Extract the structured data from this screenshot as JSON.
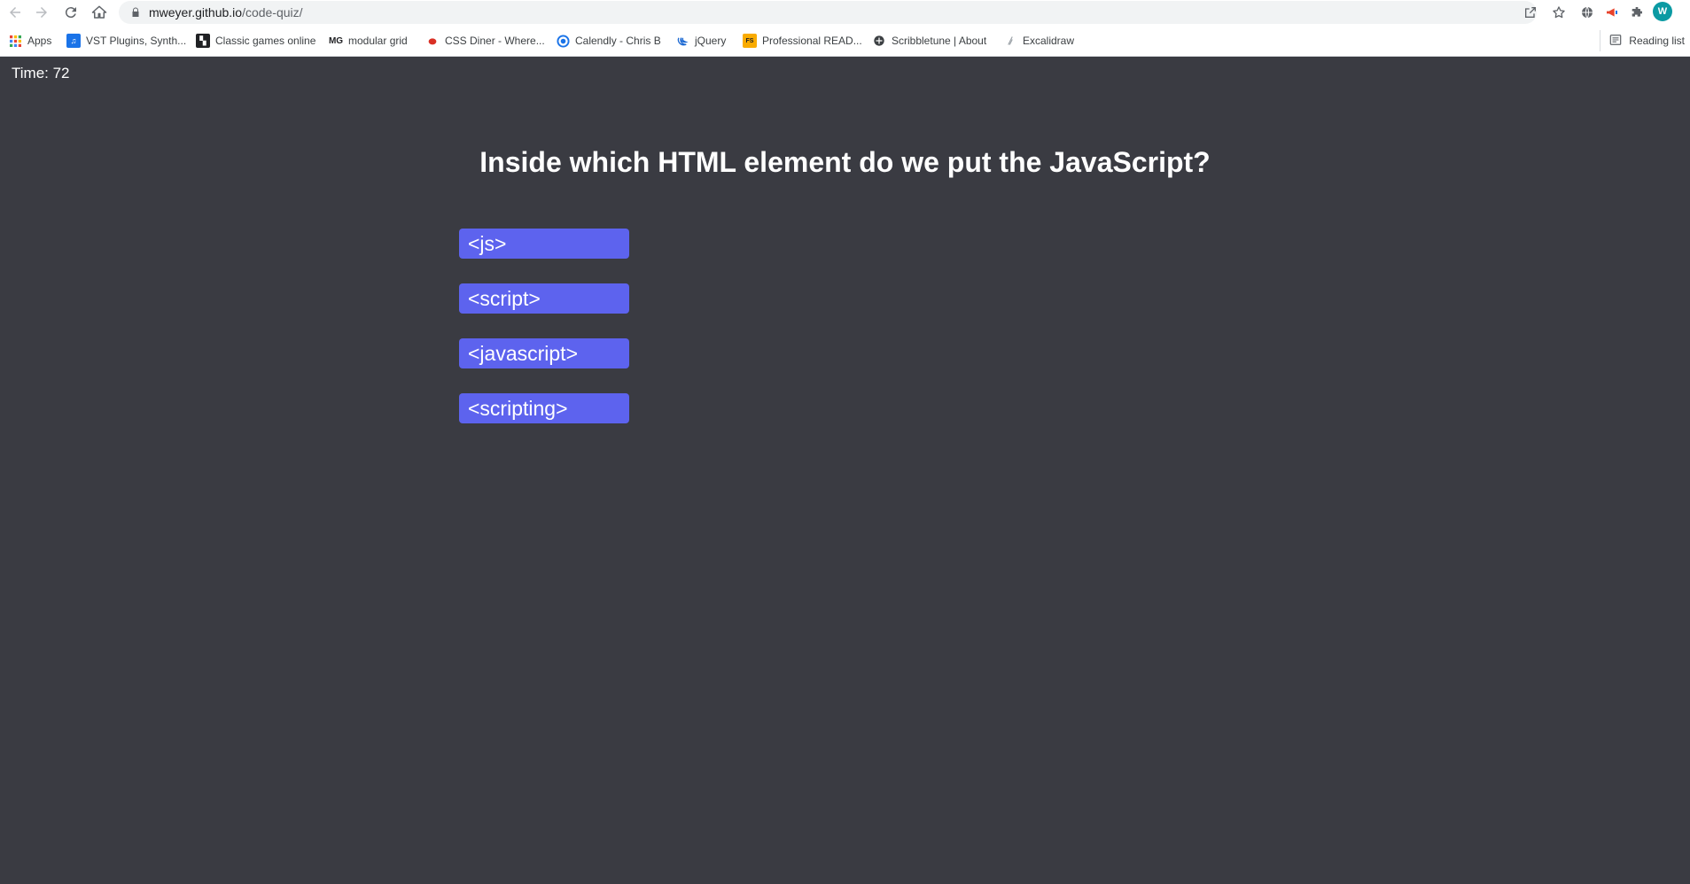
{
  "browser": {
    "url_host": "mweyer.github.io",
    "url_path": "/code-quiz/",
    "avatar_letter": "W",
    "bookmarks": [
      {
        "label": "Apps",
        "icon": "apps-grid-icon",
        "color": "#ea4335"
      },
      {
        "label": "VST Plugins, Synth...",
        "icon": "vst-favicon",
        "color": "#1a73e8"
      },
      {
        "label": "Classic games online",
        "icon": "games-favicon",
        "color": "#202124"
      },
      {
        "label": "modular grid",
        "icon": "mg-favicon",
        "color": "#202124"
      },
      {
        "label": "CSS Diner - Where...",
        "icon": "css-diner-favicon",
        "color": "#d93025"
      },
      {
        "label": "Calendly - Chris B",
        "icon": "calendly-favicon",
        "color": "#1a73e8"
      },
      {
        "label": "jQuery",
        "icon": "jquery-favicon",
        "color": "#1967d2"
      },
      {
        "label": "Professional READ...",
        "icon": "readme-favicon",
        "color": "#f9ab00"
      },
      {
        "label": "Scribbletune | About",
        "icon": "scribbletune-favicon",
        "color": "#3c4043"
      },
      {
        "label": "Excalidraw",
        "icon": "excalidraw-favicon",
        "color": "#9aa0a6"
      }
    ],
    "reading_list": "Reading list"
  },
  "quiz": {
    "timer": "Time: 72",
    "question": "Inside which HTML element do we put the JavaScript?",
    "answers": [
      "<js>",
      "<script>",
      "<javascript>",
      "<scripting>"
    ],
    "colors": {
      "background": "#3a3b42",
      "button": "#5d63ee",
      "text": "#ffffff"
    }
  }
}
